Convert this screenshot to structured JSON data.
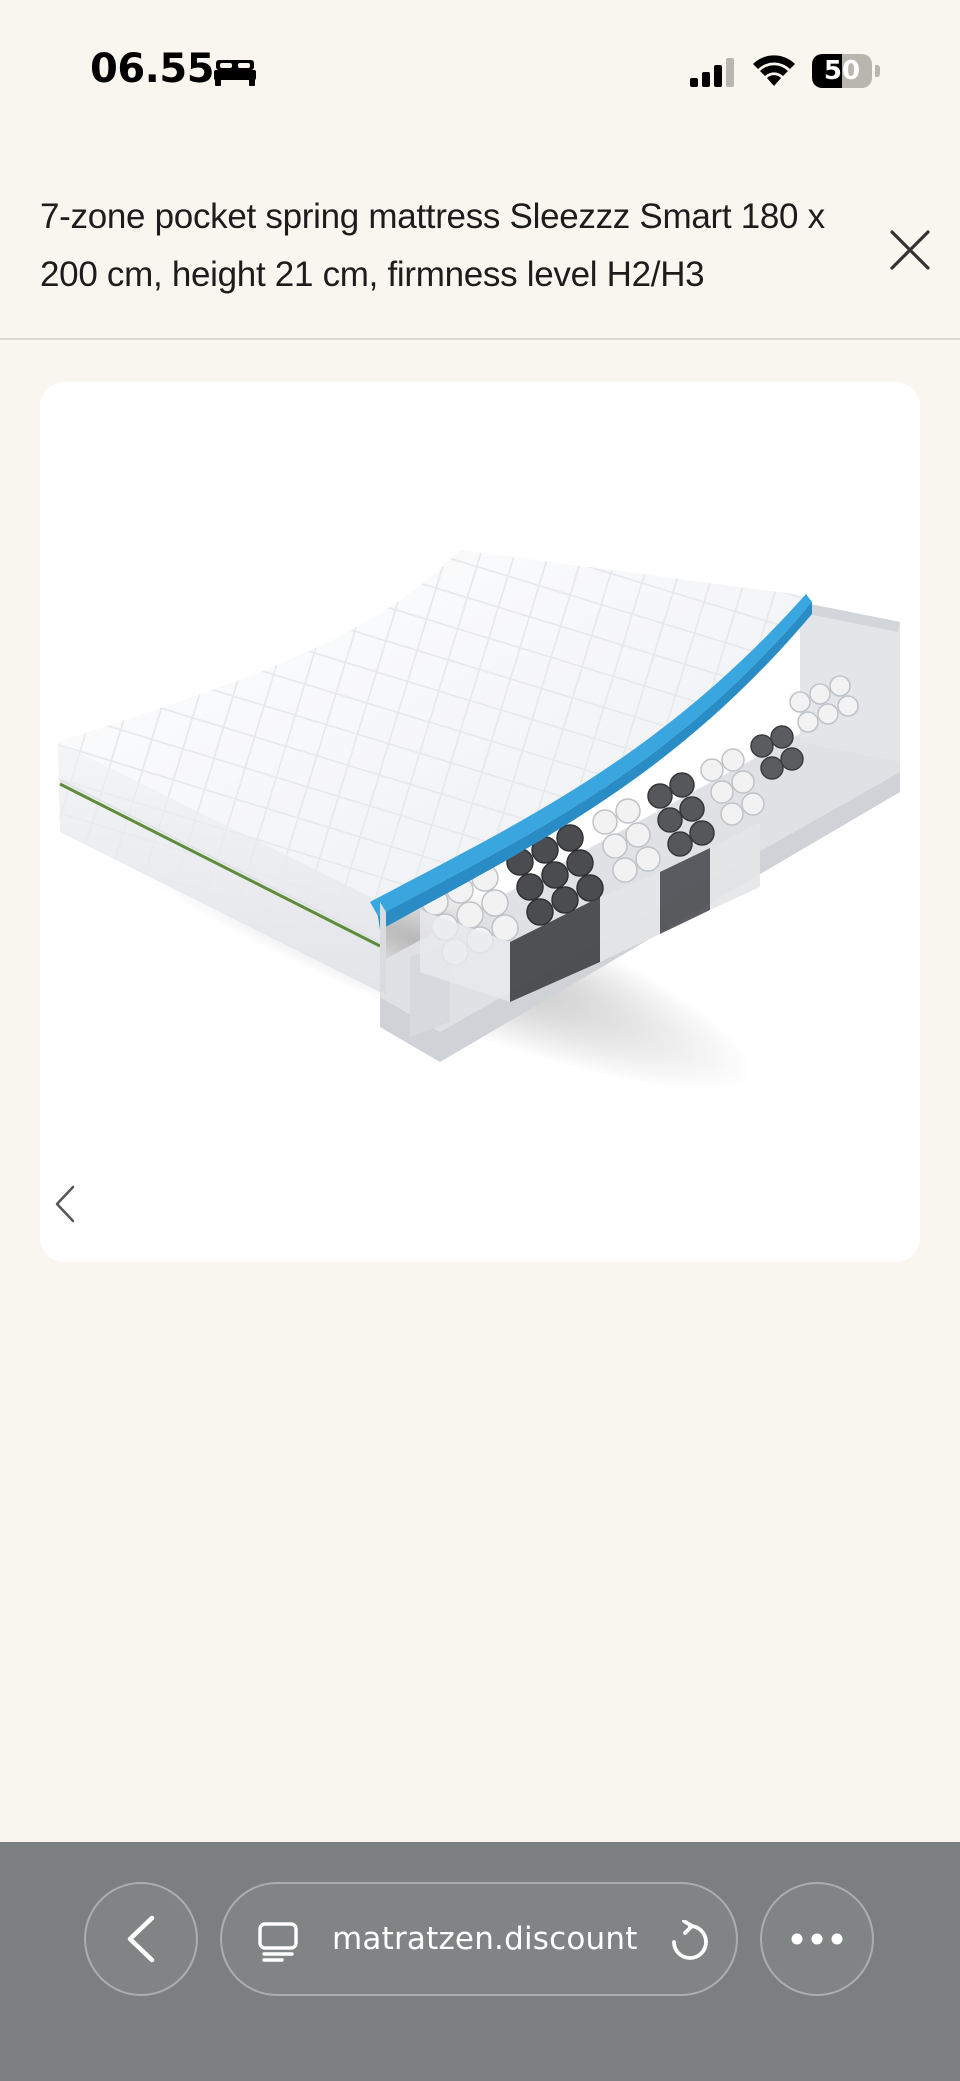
{
  "status_bar": {
    "time": "06.55",
    "battery_percent": 50,
    "battery_label": "50",
    "icons": [
      "sleep-focus-icon",
      "cellular-signal-icon",
      "wifi-icon",
      "battery-icon"
    ]
  },
  "header": {
    "title": "7-zone pocket spring mattress Sleezzz Smart 180 x 200 cm, height 21 cm, firmness level H2/H3",
    "close_icon": "close-icon"
  },
  "gallery": {
    "prev_icon": "chevron-left-icon",
    "next_icon": "chevron-right-icon",
    "image_subject": "mattress-cutaway"
  },
  "toolbar": {
    "back_icon": "chevron-left-icon",
    "tabs_icon": "tabs-icon",
    "url": "matratzen.discount",
    "reload_icon": "reload-icon",
    "more_icon": "more-icon"
  },
  "colors": {
    "page_background": "#f9f6f0",
    "card_background": "#ffffff",
    "toolbar_background": "#7b7f7f",
    "foam_accent": "#3aa6e0"
  }
}
